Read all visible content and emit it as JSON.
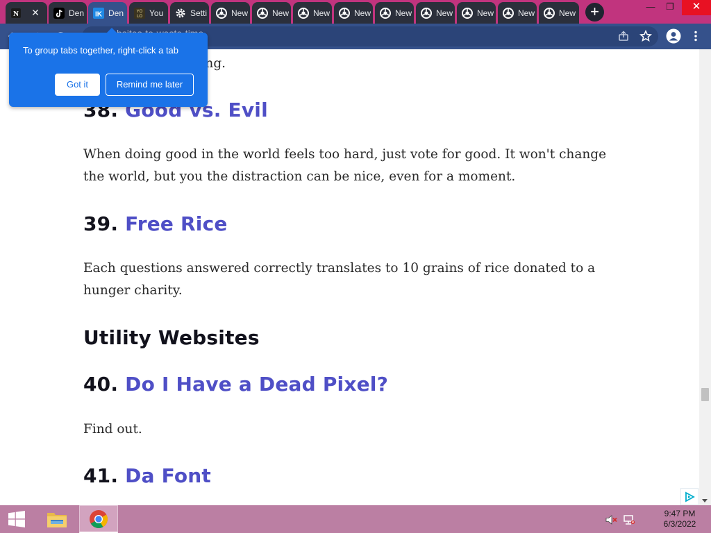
{
  "browser": {
    "tabs": [
      {
        "title": "",
        "active": false,
        "favicon": "notion-icon"
      },
      {
        "title": "Den",
        "active": false,
        "favicon": "tiktok-icon"
      },
      {
        "title": "Den",
        "active": true,
        "favicon": "ik-icon"
      },
      {
        "title": "You",
        "active": false,
        "favicon": "yolo-icon"
      },
      {
        "title": "Setti",
        "active": false,
        "favicon": "gear-icon"
      },
      {
        "title": "New",
        "active": false,
        "favicon": "chrome-icon"
      },
      {
        "title": "New",
        "active": false,
        "favicon": "chrome-icon"
      },
      {
        "title": "New",
        "active": false,
        "favicon": "chrome-icon"
      },
      {
        "title": "New",
        "active": false,
        "favicon": "chrome-icon"
      },
      {
        "title": "New",
        "active": false,
        "favicon": "chrome-icon"
      },
      {
        "title": "New",
        "active": false,
        "favicon": "chrome-icon"
      },
      {
        "title": "New",
        "active": false,
        "favicon": "chrome-icon"
      },
      {
        "title": "New",
        "active": false,
        "favicon": "chrome-icon"
      },
      {
        "title": "New",
        "active": false,
        "favicon": "chrome-icon"
      }
    ],
    "new_tab_label": "+",
    "address": "bsites-to-waste-time",
    "colors": {
      "frame": "#c1347e",
      "toolbar": "#35518b",
      "tab_inactive": "#2b2f3b"
    }
  },
  "promo": {
    "text": "To group tabs together, right-click a tab",
    "primary_button": "Got it",
    "secondary_button": "Remind me later",
    "color": "#1a73e8"
  },
  "article": {
    "top_fragment": "nd of rain is soothing.",
    "items": [
      {
        "number": "38.",
        "title": "Good vs. Evil",
        "description": "When doing good in the world feels too hard, just vote for good. It won't change the world, but you the distraction can be nice, even for a moment."
      },
      {
        "number": "39.",
        "title": "Free Rice",
        "description": "Each questions answered correctly translates to 10 grains of rice donated to a hunger charity."
      },
      {
        "number": "40.",
        "title": "Do I Have a Dead Pixel?",
        "description": "Find out."
      },
      {
        "number": "41.",
        "title": "Da Font",
        "description": ""
      }
    ],
    "section_heading": "Utility Websites",
    "link_color": "#4f4fc6"
  },
  "taskbar": {
    "time": "9:47 PM",
    "date": "6/3/2022",
    "apps": [
      "file-explorer-icon",
      "chrome-icon"
    ],
    "tray": [
      "speaker-muted-icon",
      "network-icon"
    ],
    "color": "#bb7fa3"
  }
}
